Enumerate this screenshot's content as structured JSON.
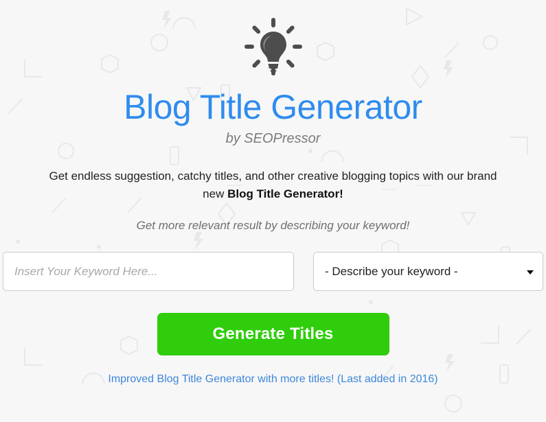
{
  "page": {
    "background_color": "#f7f7f8",
    "accent_blue": "#2f8ced",
    "accent_green": "#2fcd0c",
    "link_blue": "#3d87d8"
  },
  "logo": {
    "icon": "lightbulb-icon",
    "color": "#4d4d4d"
  },
  "header": {
    "title": "Blog Title Generator",
    "byline": "by SEOPressor"
  },
  "description": {
    "lead": "Get endless suggestion, catchy titles, and other creative blogging topics with our brand new ",
    "emphasis": "Blog Title Generator!",
    "hint": "Get more relevant result by describing your keyword!"
  },
  "form": {
    "keyword_input": {
      "value": "",
      "placeholder": "Insert Your Keyword Here..."
    },
    "describe_select": {
      "selected": "- Describe your keyword -",
      "options": [
        "- Describe your keyword -"
      ]
    },
    "generate_button": "Generate Titles"
  },
  "footer": {
    "link_text": "Improved Blog Title Generator with more titles! (Last added in 2016)"
  }
}
